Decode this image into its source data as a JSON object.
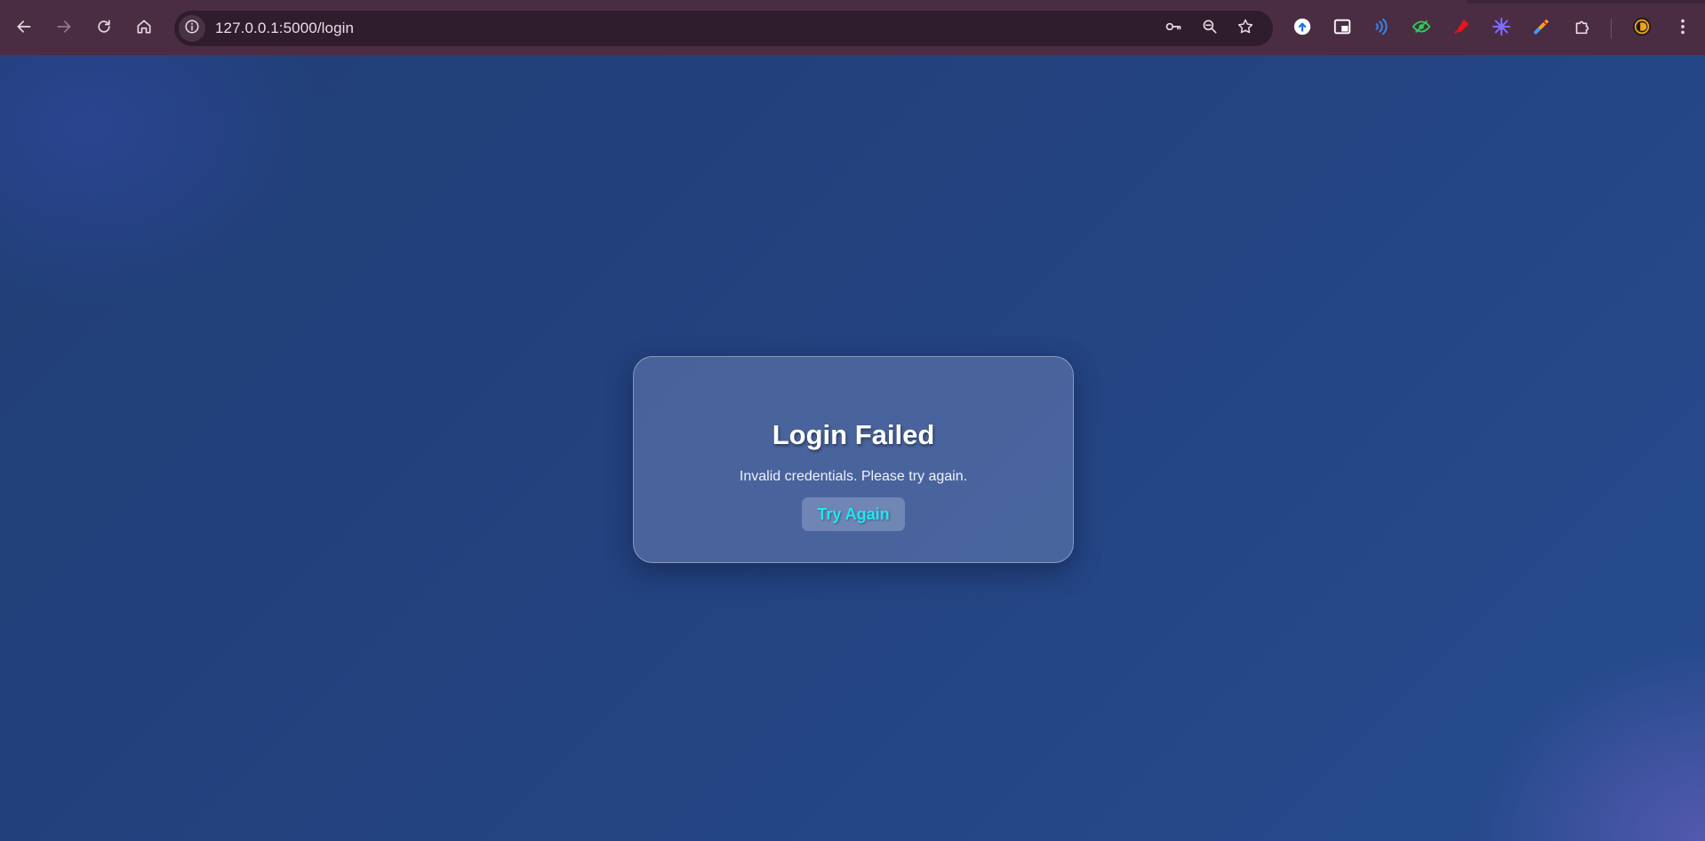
{
  "browser": {
    "url": "127.0.0.1:5000/login",
    "nav": {
      "back_icon": "arrow-left-icon",
      "forward_icon": "arrow-right-icon",
      "reload_icon": "reload-icon",
      "home_icon": "home-icon"
    },
    "omnibox_icons": [
      "site-info-icon",
      "password-key-icon",
      "zoom-out-icon",
      "bookmark-star-icon"
    ],
    "extensions": [
      "cloud-upload-icon",
      "picture-in-picture-icon",
      "read-aloud-icon",
      "eye-extension-icon",
      "highlighter-icon",
      "color-wheel-icon",
      "color-picker-icon",
      "puzzle-extensions-icon",
      "profile-avatar-icon",
      "more-menu-icon"
    ],
    "colors": {
      "toolbar": "#4a2d43",
      "omnibox": "#2f1c2c"
    }
  },
  "page": {
    "card": {
      "title": "Login Failed",
      "message": "Invalid credentials. Please try again.",
      "button_label": "Try Again"
    },
    "colors": {
      "background": "#23427f",
      "button_text": "#22e6f2",
      "title": "#ffffff"
    }
  }
}
